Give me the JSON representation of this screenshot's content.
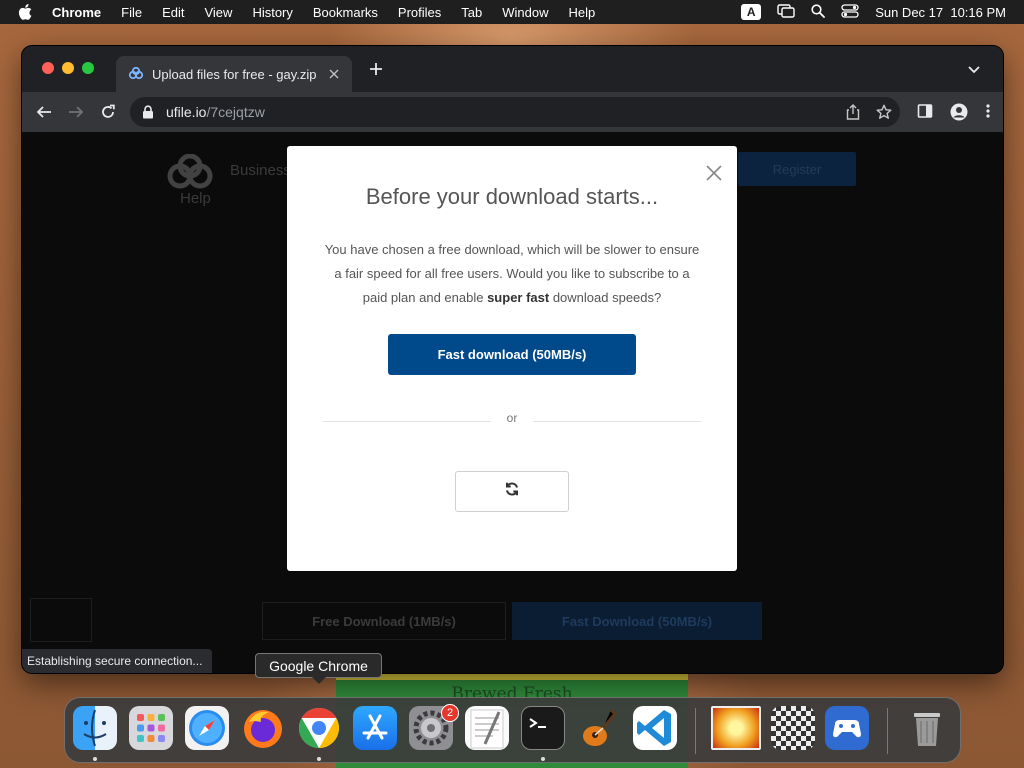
{
  "menubar": {
    "app_name": "Chrome",
    "items": [
      "File",
      "Edit",
      "View",
      "History",
      "Bookmarks",
      "Profiles",
      "Tab",
      "Window",
      "Help"
    ],
    "input_source": "A",
    "clock": "Sun Dec 17  10:16 PM"
  },
  "browser": {
    "tab_title": "Upload files for free - gay.zip",
    "url_host": "ufile.io",
    "url_path": "/7cejqtzw",
    "status_text": "Establishing secure connection..."
  },
  "page_background": {
    "nav_business": "Business",
    "nav_help": "Help",
    "register": "Register",
    "free_download": "Free Download (1MB/s)",
    "fast_download": "Fast Download (50MB/s)"
  },
  "modal": {
    "heading": "Before your download starts...",
    "body_before": "You have chosen a free download, which will be slower to ensure a fair speed for all free users. Would you like to subscribe to a paid plan and enable ",
    "body_bold": "super fast",
    "body_after": " download speeds?",
    "fast_button": "Fast download (50MB/s)",
    "or_text": "or",
    "loading_icon": "refresh-icon"
  },
  "tooltip": {
    "text": "Google Chrome"
  },
  "wallpaper": {
    "banner_text": "Brewed Fresh"
  },
  "dock": {
    "apps": [
      {
        "name": "Finder",
        "icon": "finder-icon",
        "running": true
      },
      {
        "name": "Launchpad",
        "icon": "launchpad-icon",
        "running": false
      },
      {
        "name": "Safari",
        "icon": "safari-icon",
        "running": false
      },
      {
        "name": "Firefox",
        "icon": "firefox-icon",
        "running": false
      },
      {
        "name": "Google Chrome",
        "icon": "chrome-icon",
        "running": true
      },
      {
        "name": "App Store",
        "icon": "app-store-icon",
        "running": false
      },
      {
        "name": "System Preferences",
        "icon": "system-preferences-icon",
        "running": false,
        "badge": "2"
      },
      {
        "name": "TextEdit",
        "icon": "textedit-icon",
        "running": false
      },
      {
        "name": "Terminal",
        "icon": "terminal-icon",
        "running": true
      },
      {
        "name": "GarageBand",
        "icon": "garageband-icon",
        "running": false
      },
      {
        "name": "Visual Studio Code",
        "icon": "vscode-icon",
        "running": false
      }
    ]
  },
  "colors": {
    "menubar": "#1f1f1f",
    "modal_button": "#00498a",
    "tab_active": "#35363a",
    "window_bg": "#202124"
  }
}
